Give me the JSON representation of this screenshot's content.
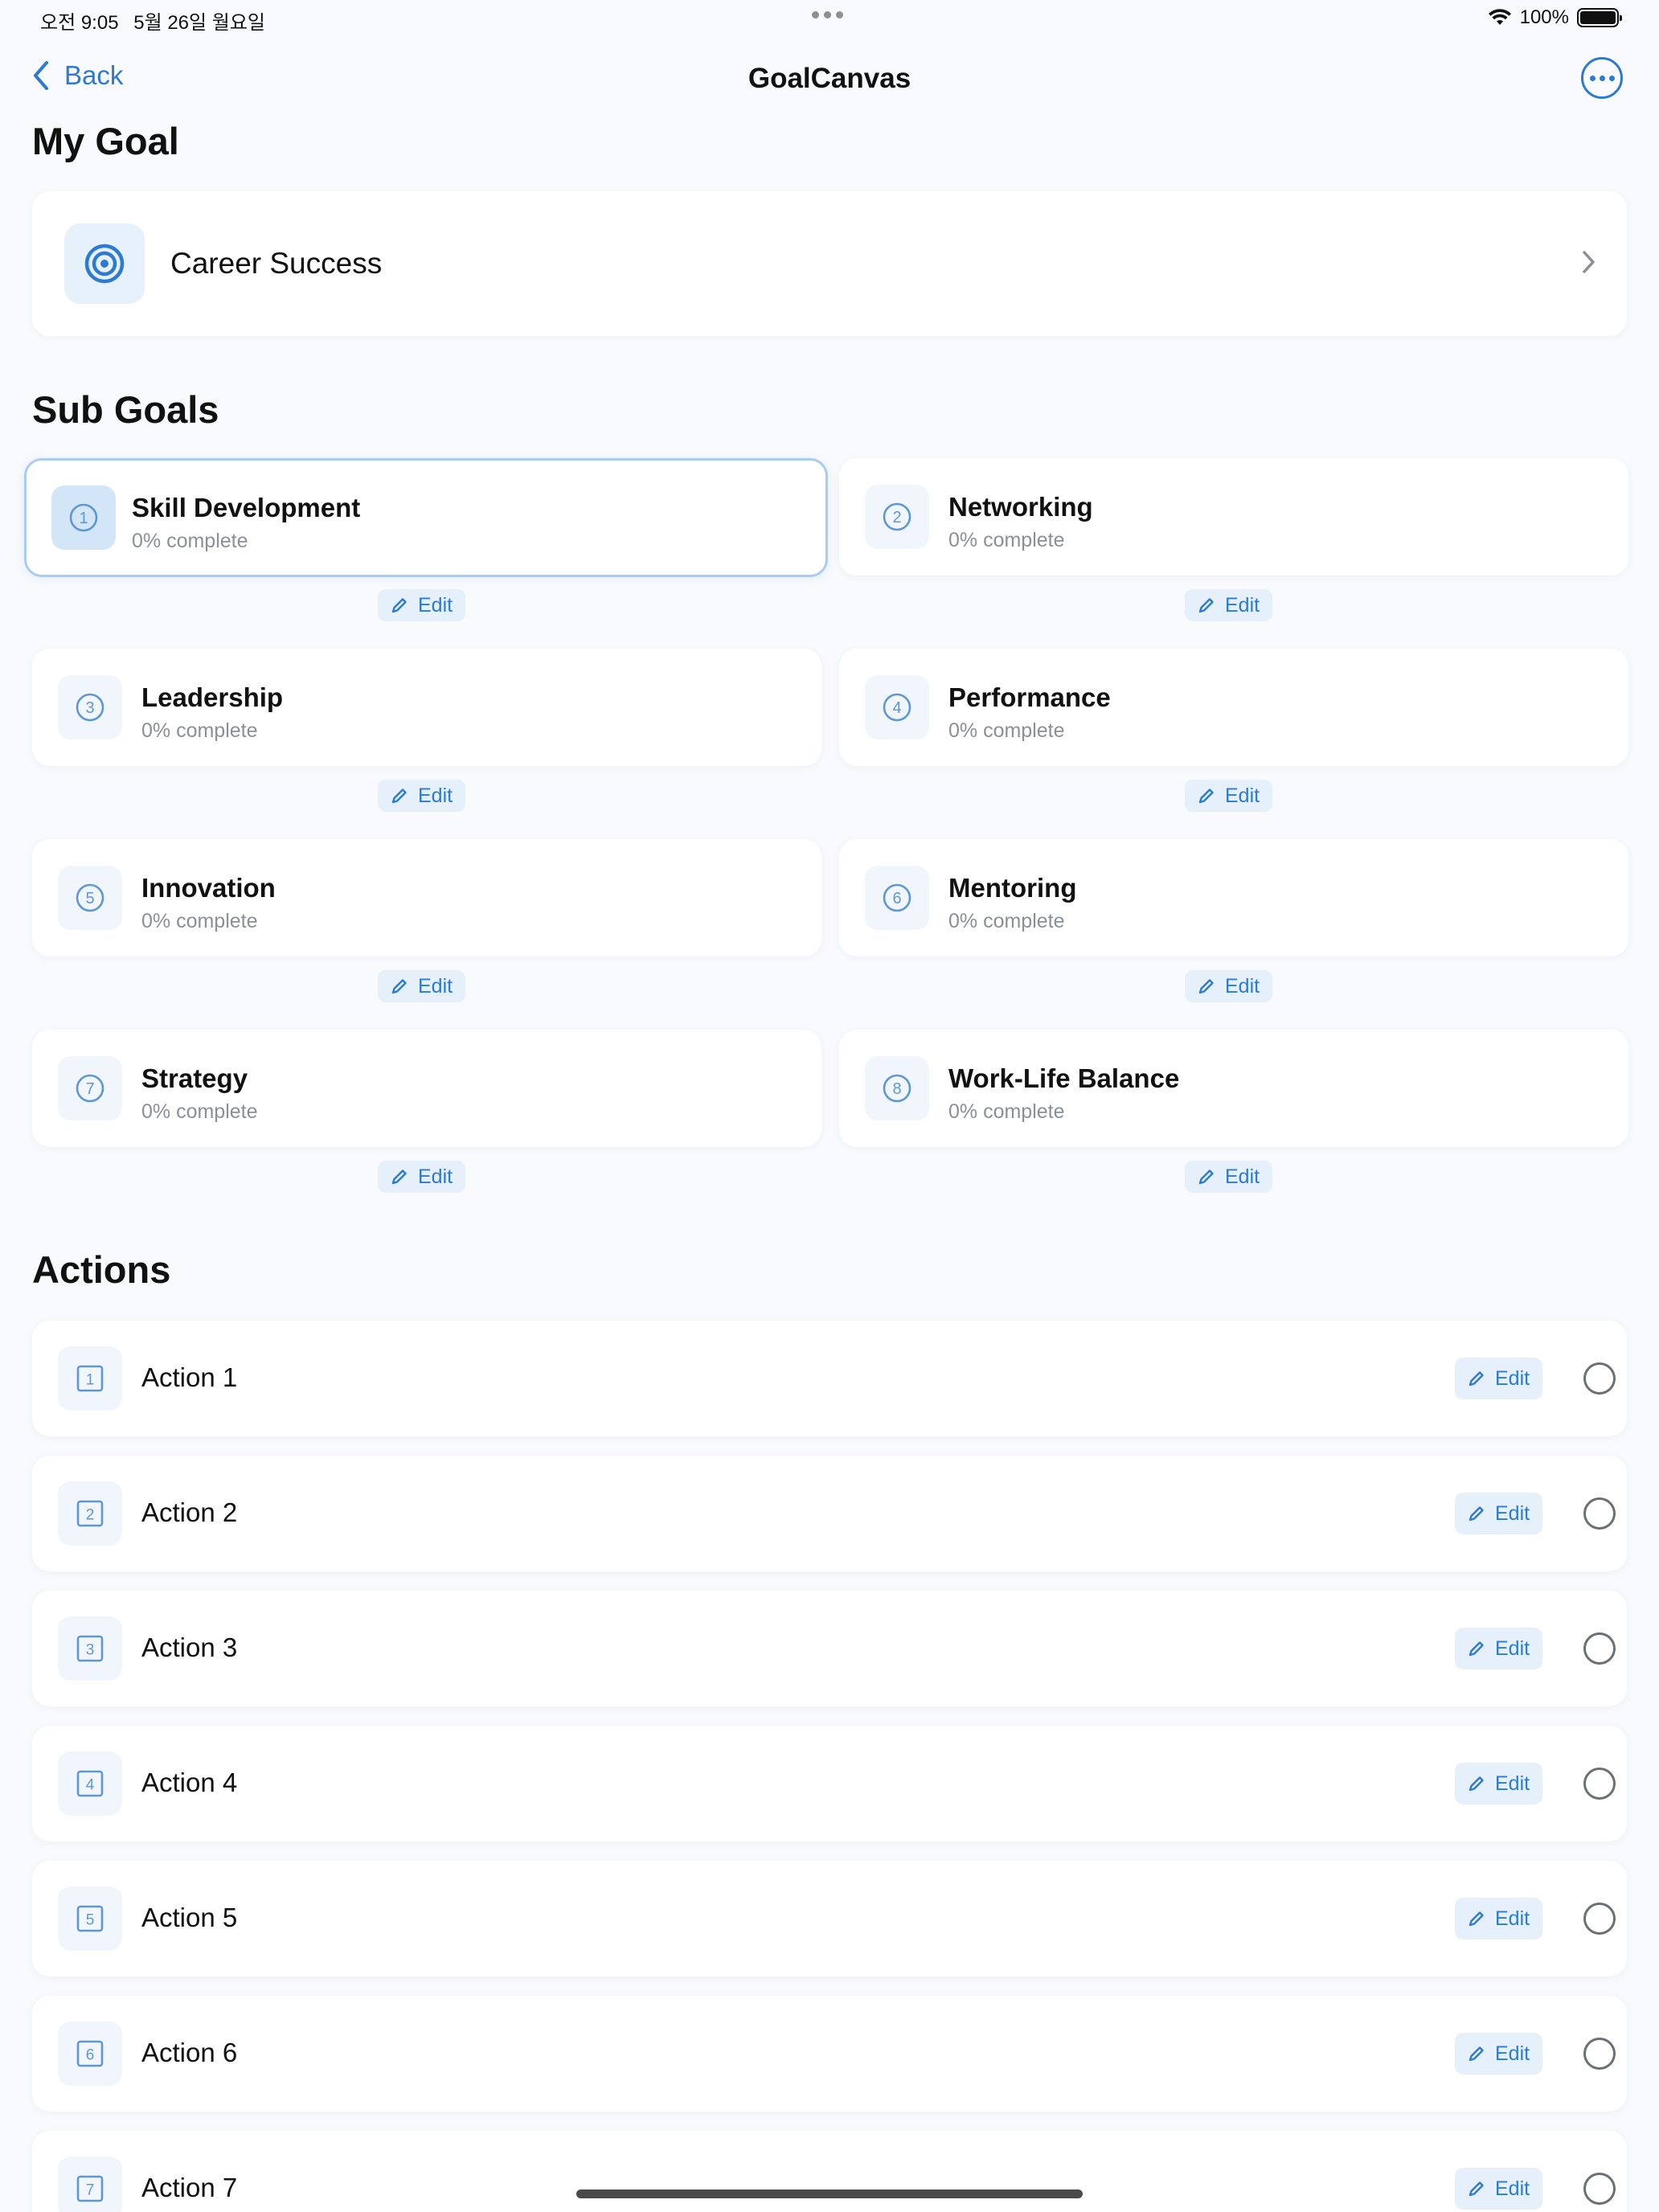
{
  "status_bar": {
    "time": "오전 9:05",
    "date": "5월 26일 월요일",
    "battery": "100%"
  },
  "nav": {
    "back_label": "Back",
    "title": "GoalCanvas"
  },
  "goal_section": {
    "title": "My Goal",
    "goal": "Career Success"
  },
  "subgoal_section": {
    "title": "Sub Goals",
    "edit_label": "Edit",
    "items": [
      {
        "number": "1",
        "name": "Skill Development",
        "progress": "0% complete"
      },
      {
        "number": "2",
        "name": "Networking",
        "progress": "0% complete"
      },
      {
        "number": "3",
        "name": "Leadership",
        "progress": "0% complete"
      },
      {
        "number": "4",
        "name": "Performance",
        "progress": "0% complete"
      },
      {
        "number": "5",
        "name": "Innovation",
        "progress": "0% complete"
      },
      {
        "number": "6",
        "name": "Mentoring",
        "progress": "0% complete"
      },
      {
        "number": "7",
        "name": "Strategy",
        "progress": "0% complete"
      },
      {
        "number": "8",
        "name": "Work-Life Balance",
        "progress": "0% complete"
      }
    ]
  },
  "actions_section": {
    "title": "Actions",
    "edit_label": "Edit",
    "items": [
      {
        "number": "1",
        "name": "Action 1"
      },
      {
        "number": "2",
        "name": "Action 2"
      },
      {
        "number": "3",
        "name": "Action 3"
      },
      {
        "number": "4",
        "name": "Action 4"
      },
      {
        "number": "5",
        "name": "Action 5"
      },
      {
        "number": "6",
        "name": "Action 6"
      },
      {
        "number": "7",
        "name": "Action 7"
      }
    ]
  },
  "colors": {
    "accent": "#2c7bd0",
    "background": "#f8fafd",
    "icon_bg": "#f1f6fc",
    "selected_border": "#a9cdf0"
  },
  "icons": {
    "goal": "target-icon",
    "subgoal": "circled-number-icon",
    "action": "squared-number-icon",
    "edit": "pencil-icon",
    "more": "ellipsis-circle-icon",
    "back": "chevron-left-icon",
    "goal_disclosure": "chevron-right-icon",
    "complete": "empty-circle-icon"
  }
}
